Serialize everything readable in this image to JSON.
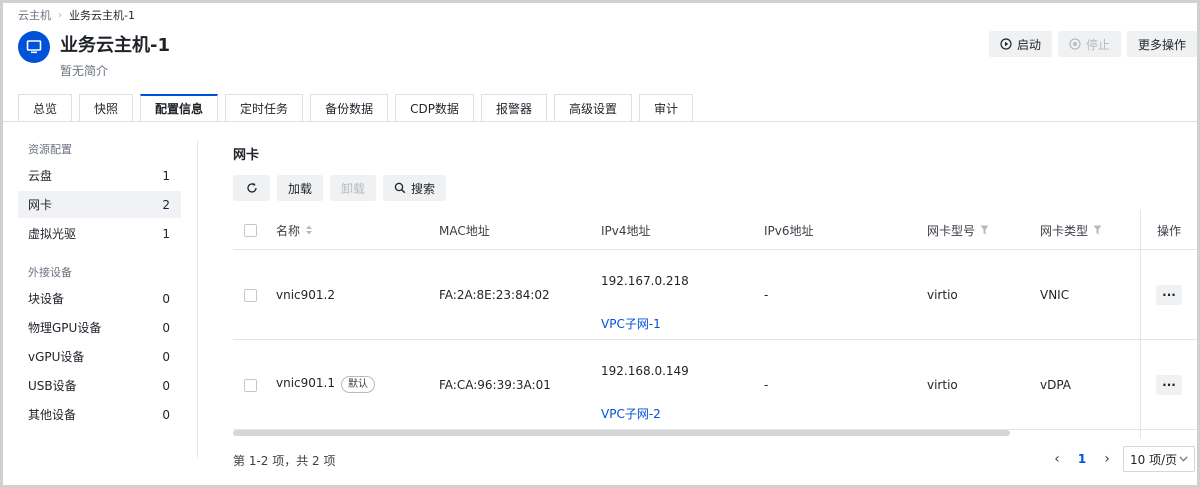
{
  "breadcrumb": {
    "root": "云主机",
    "current": "业务云主机-1"
  },
  "header": {
    "title": "业务云主机-1",
    "subtitle": "暂无简介",
    "avatar_icon": "monitor-icon",
    "accent": "#0052d9"
  },
  "actions": {
    "start": "启动",
    "stop": "停止",
    "more": "更多操作"
  },
  "tabs": [
    {
      "label": "总览"
    },
    {
      "label": "快照"
    },
    {
      "label": "配置信息",
      "active": true
    },
    {
      "label": "定时任务"
    },
    {
      "label": "备份数据"
    },
    {
      "label": "CDP数据"
    },
    {
      "label": "报警器"
    },
    {
      "label": "高级设置"
    },
    {
      "label": "审计"
    }
  ],
  "side": {
    "group1": "资源配置",
    "resources": [
      {
        "label": "云盘",
        "count": "1"
      },
      {
        "label": "网卡",
        "count": "2",
        "active": true
      },
      {
        "label": "虚拟光驱",
        "count": "1"
      }
    ],
    "group2": "外接设备",
    "devices": [
      {
        "label": "块设备",
        "count": "0"
      },
      {
        "label": "物理GPU设备",
        "count": "0"
      },
      {
        "label": "vGPU设备",
        "count": "0"
      },
      {
        "label": "USB设备",
        "count": "0"
      },
      {
        "label": "其他设备",
        "count": "0"
      }
    ]
  },
  "main": {
    "section_title": "网卡",
    "toolbar": {
      "attach": "加载",
      "detach": "卸载",
      "search": "搜索"
    },
    "columns": {
      "name": "名称",
      "mac": "MAC地址",
      "ipv4": "IPv4地址",
      "ipv6": "IPv6地址",
      "model": "网卡型号",
      "type": "网卡类型",
      "ops": "操作"
    },
    "rows": [
      {
        "name": "vnic901.2",
        "tag": "",
        "mac": "FA:2A:8E:23:84:02",
        "ipv4": "192.167.0.218",
        "subnet": "VPC子网-1",
        "ipv6": "-",
        "model": "virtio",
        "type": "VNIC"
      },
      {
        "name": "vnic901.1",
        "tag": "默认",
        "mac": "FA:CA:96:39:3A:01",
        "ipv4": "192.168.0.149",
        "subnet": "VPC子网-2",
        "ipv6": "-",
        "model": "virtio",
        "type": "vDPA"
      }
    ]
  },
  "pagination": {
    "total": "第 1-2 项，共 2 项",
    "page": "1",
    "page_size": "10 项/页"
  }
}
